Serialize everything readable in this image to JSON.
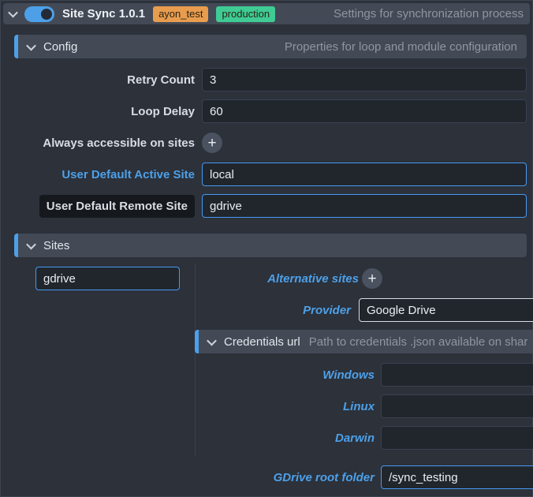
{
  "topbar": {
    "title": "Site Sync 1.0.1",
    "description": "Settings for synchronization process",
    "toggle_on": true,
    "badges": [
      {
        "label": "ayon_test",
        "color": "#e89c4e"
      },
      {
        "label": "production",
        "color": "#3fcb94"
      }
    ]
  },
  "config": {
    "title": "Config",
    "description": "Properties for loop and module configuration",
    "retry_count": {
      "label": "Retry Count",
      "value": "3"
    },
    "loop_delay": {
      "label": "Loop Delay",
      "value": "60"
    },
    "always_accessible": {
      "label": "Always accessible on sites",
      "add_button": "+"
    },
    "active_site": {
      "label": "User Default Active Site",
      "value": "local"
    },
    "remote_site": {
      "label": "User Default Remote Site",
      "value": "gdrive"
    }
  },
  "sites": {
    "title": "Sites",
    "site_name": {
      "value": "gdrive"
    },
    "alternative_sites": {
      "label": "Alternative sites",
      "add_button": "+"
    },
    "provider": {
      "label": "Provider",
      "value": "Google Drive"
    },
    "credentials": {
      "title": "Credentials url",
      "description": "Path to credentials .json available on shar",
      "windows": {
        "label": "Windows",
        "value": ""
      },
      "linux": {
        "label": "Linux",
        "value": ""
      },
      "darwin": {
        "label": "Darwin",
        "value": ""
      }
    },
    "gdrive_root": {
      "label": "GDrive root folder",
      "value": "/sync_testing"
    }
  },
  "colors": {
    "background": "#2c313a",
    "section_bar": "#434a56",
    "accent_blue": "#4da0e8",
    "modified_border": "#4799f4",
    "input_background": "#21262d",
    "badge_orange": "#e89c4e",
    "badge_green": "#3fcb94"
  }
}
